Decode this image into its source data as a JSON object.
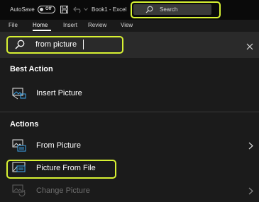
{
  "titlebar": {
    "autosave_label": "AutoSave",
    "autosave_state": "Off",
    "document_title": "Book1 - Excel",
    "search_placeholder": "Search"
  },
  "ribbon": {
    "tabs": [
      "File",
      "Home",
      "Insert",
      "Review",
      "View"
    ],
    "active_tab": "Home"
  },
  "search": {
    "query": "from picture"
  },
  "results": {
    "best_action": {
      "heading": "Best Action",
      "items": [
        {
          "label": "Insert Picture",
          "icon": "insert-picture-icon"
        }
      ]
    },
    "actions": {
      "heading": "Actions",
      "items": [
        {
          "label": "From Picture",
          "icon": "from-picture-icon",
          "submenu": true
        },
        {
          "label": "Picture From File",
          "icon": "picture-from-file-icon",
          "submenu": false
        },
        {
          "label": "Change Picture",
          "icon": "change-picture-icon",
          "submenu": true,
          "disabled": true
        }
      ]
    }
  },
  "colors": {
    "highlight": "#d8f233",
    "background": "#1b1b1b",
    "titlebar": "#0a0a0a",
    "icon_blue": "#3a9ad9"
  }
}
